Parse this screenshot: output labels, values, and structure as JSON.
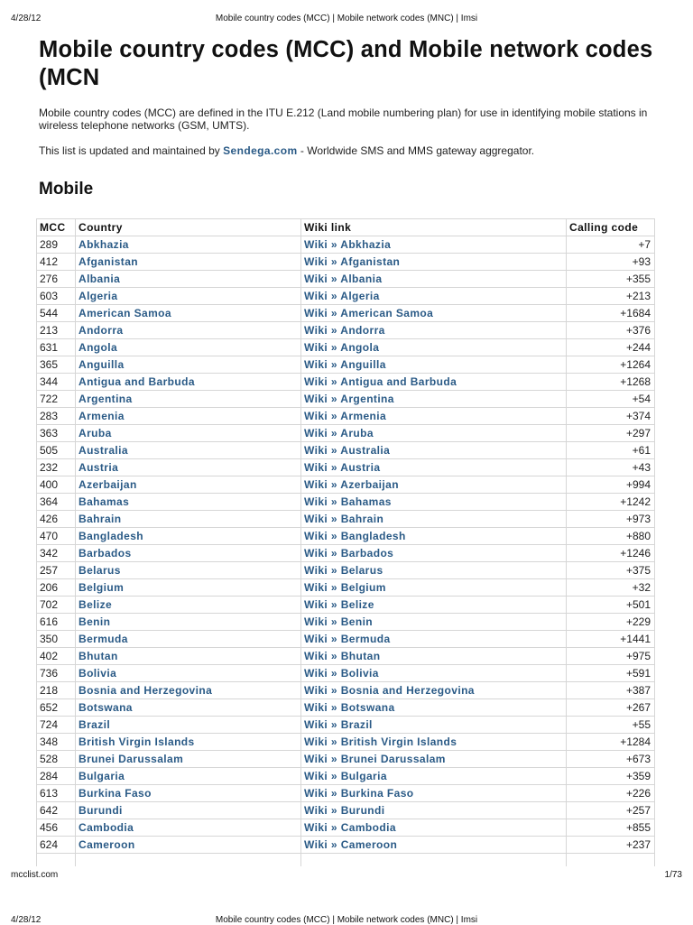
{
  "print_header": {
    "date": "4/28/12",
    "title": "Mobile country codes (MCC) | Mobile network codes (MNC) | Imsi"
  },
  "page": {
    "title": "Mobile country codes (MCC) and Mobile network codes (MCN",
    "intro": "Mobile country codes (MCC) are defined in the ITU E.212 (Land mobile numbering plan) for use in identifying mobile stations in wireless telephone networks (GSM, UMTS).",
    "maintained_prefix": "This list is updated and maintained by ",
    "maintained_link": "Sendega.com",
    "maintained_suffix": " - Worldwide SMS and MMS gateway aggregator.",
    "section_title": "Mobile"
  },
  "table": {
    "headers": {
      "mcc": "MCC",
      "country": "Country",
      "wiki": "Wiki link",
      "calling": "Calling code"
    },
    "rows": [
      {
        "mcc": "289",
        "country": "Abkhazia",
        "wiki": "Wiki » Abkhazia",
        "calling": "+7"
      },
      {
        "mcc": "412",
        "country": "Afganistan",
        "wiki": "Wiki » Afganistan",
        "calling": "+93"
      },
      {
        "mcc": "276",
        "country": "Albania",
        "wiki": "Wiki » Albania",
        "calling": "+355"
      },
      {
        "mcc": "603",
        "country": "Algeria",
        "wiki": "Wiki » Algeria",
        "calling": "+213"
      },
      {
        "mcc": "544",
        "country": "American Samoa",
        "wiki": "Wiki » American Samoa",
        "calling": "+1684"
      },
      {
        "mcc": "213",
        "country": "Andorra",
        "wiki": "Wiki » Andorra",
        "calling": "+376"
      },
      {
        "mcc": "631",
        "country": "Angola",
        "wiki": "Wiki » Angola",
        "calling": "+244"
      },
      {
        "mcc": "365",
        "country": "Anguilla",
        "wiki": "Wiki » Anguilla",
        "calling": "+1264"
      },
      {
        "mcc": "344",
        "country": "Antigua and Barbuda",
        "wiki": "Wiki » Antigua and Barbuda",
        "calling": "+1268"
      },
      {
        "mcc": "722",
        "country": "Argentina",
        "wiki": "Wiki » Argentina",
        "calling": "+54"
      },
      {
        "mcc": "283",
        "country": "Armenia",
        "wiki": "Wiki » Armenia",
        "calling": "+374"
      },
      {
        "mcc": "363",
        "country": "Aruba",
        "wiki": "Wiki » Aruba",
        "calling": "+297"
      },
      {
        "mcc": "505",
        "country": "Australia",
        "wiki": "Wiki » Australia",
        "calling": "+61"
      },
      {
        "mcc": "232",
        "country": "Austria",
        "wiki": "Wiki » Austria",
        "calling": "+43"
      },
      {
        "mcc": "400",
        "country": "Azerbaijan",
        "wiki": "Wiki » Azerbaijan",
        "calling": "+994"
      },
      {
        "mcc": "364",
        "country": "Bahamas",
        "wiki": "Wiki » Bahamas",
        "calling": "+1242"
      },
      {
        "mcc": "426",
        "country": "Bahrain",
        "wiki": "Wiki » Bahrain",
        "calling": "+973"
      },
      {
        "mcc": "470",
        "country": "Bangladesh",
        "wiki": "Wiki » Bangladesh",
        "calling": "+880"
      },
      {
        "mcc": "342",
        "country": "Barbados",
        "wiki": "Wiki » Barbados",
        "calling": "+1246"
      },
      {
        "mcc": "257",
        "country": "Belarus",
        "wiki": "Wiki » Belarus",
        "calling": "+375"
      },
      {
        "mcc": "206",
        "country": "Belgium",
        "wiki": "Wiki » Belgium",
        "calling": "+32"
      },
      {
        "mcc": "702",
        "country": "Belize",
        "wiki": "Wiki » Belize",
        "calling": "+501"
      },
      {
        "mcc": "616",
        "country": "Benin",
        "wiki": "Wiki » Benin",
        "calling": "+229"
      },
      {
        "mcc": "350",
        "country": "Bermuda",
        "wiki": "Wiki » Bermuda",
        "calling": "+1441"
      },
      {
        "mcc": "402",
        "country": "Bhutan",
        "wiki": "Wiki » Bhutan",
        "calling": "+975"
      },
      {
        "mcc": "736",
        "country": "Bolivia",
        "wiki": "Wiki » Bolivia",
        "calling": "+591"
      },
      {
        "mcc": "218",
        "country": "Bosnia and Herzegovina",
        "wiki": "Wiki » Bosnia and Herzegovina",
        "calling": "+387"
      },
      {
        "mcc": "652",
        "country": "Botswana",
        "wiki": "Wiki » Botswana",
        "calling": "+267"
      },
      {
        "mcc": "724",
        "country": "Brazil",
        "wiki": "Wiki » Brazil",
        "calling": "+55"
      },
      {
        "mcc": "348",
        "country": "British Virgin Islands",
        "wiki": "Wiki » British Virgin Islands",
        "calling": "+1284"
      },
      {
        "mcc": "528",
        "country": "Brunei Darussalam",
        "wiki": "Wiki » Brunei Darussalam",
        "calling": "+673"
      },
      {
        "mcc": "284",
        "country": "Bulgaria",
        "wiki": "Wiki » Bulgaria",
        "calling": "+359"
      },
      {
        "mcc": "613",
        "country": "Burkina Faso",
        "wiki": "Wiki » Burkina Faso",
        "calling": "+226"
      },
      {
        "mcc": "642",
        "country": "Burundi",
        "wiki": "Wiki » Burundi",
        "calling": "+257"
      },
      {
        "mcc": "456",
        "country": "Cambodia",
        "wiki": "Wiki » Cambodia",
        "calling": "+855"
      },
      {
        "mcc": "624",
        "country": "Cameroon",
        "wiki": "Wiki » Cameroon",
        "calling": "+237"
      }
    ]
  },
  "print_footer": {
    "site": "mcclist.com",
    "page_count": "1/73"
  },
  "print_header_next": {
    "date": "4/28/12",
    "title": "Mobile country codes (MCC) | Mobile network codes (MNC) | Imsi"
  },
  "colors": {
    "link": "#2a5a86",
    "border": "#d6d6d6",
    "text": "#222222"
  }
}
